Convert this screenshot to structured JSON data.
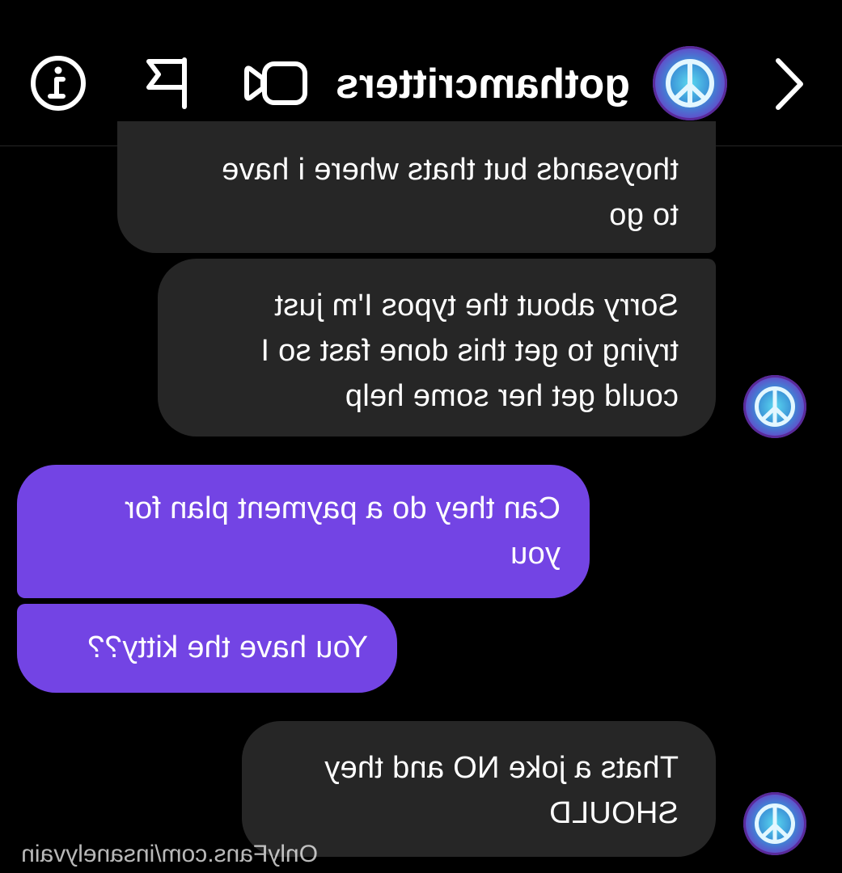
{
  "header": {
    "username": "gothamcritters",
    "back_icon": "chevron-left-icon",
    "avatar_icon": "peace-sign-icon",
    "video_icon": "video-camera-icon",
    "flag_icon": "flag-icon",
    "info_icon": "info-icon"
  },
  "messages": [
    {
      "sender": "them",
      "lines": [
        "thoysands but thats where i have",
        "to go"
      ]
    },
    {
      "sender": "them",
      "lines": [
        "Sorry about the typos I'm just",
        "trying to get this done fast so I",
        "could get her some help"
      ]
    },
    {
      "sender": "me",
      "lines": [
        "Can they do a payment plan for",
        "you"
      ]
    },
    {
      "sender": "me",
      "lines": [
        "You have the kitty??"
      ]
    },
    {
      "sender": "them",
      "lines": [
        "Thats a joke NO and they",
        "SHOULD"
      ]
    }
  ],
  "watermark": "OnlyFans.com/insanelyvain",
  "colors": {
    "background": "#000000",
    "incoming_bubble": "#262626",
    "outgoing_bubble": "#7344e4",
    "text": "#ffffff"
  }
}
